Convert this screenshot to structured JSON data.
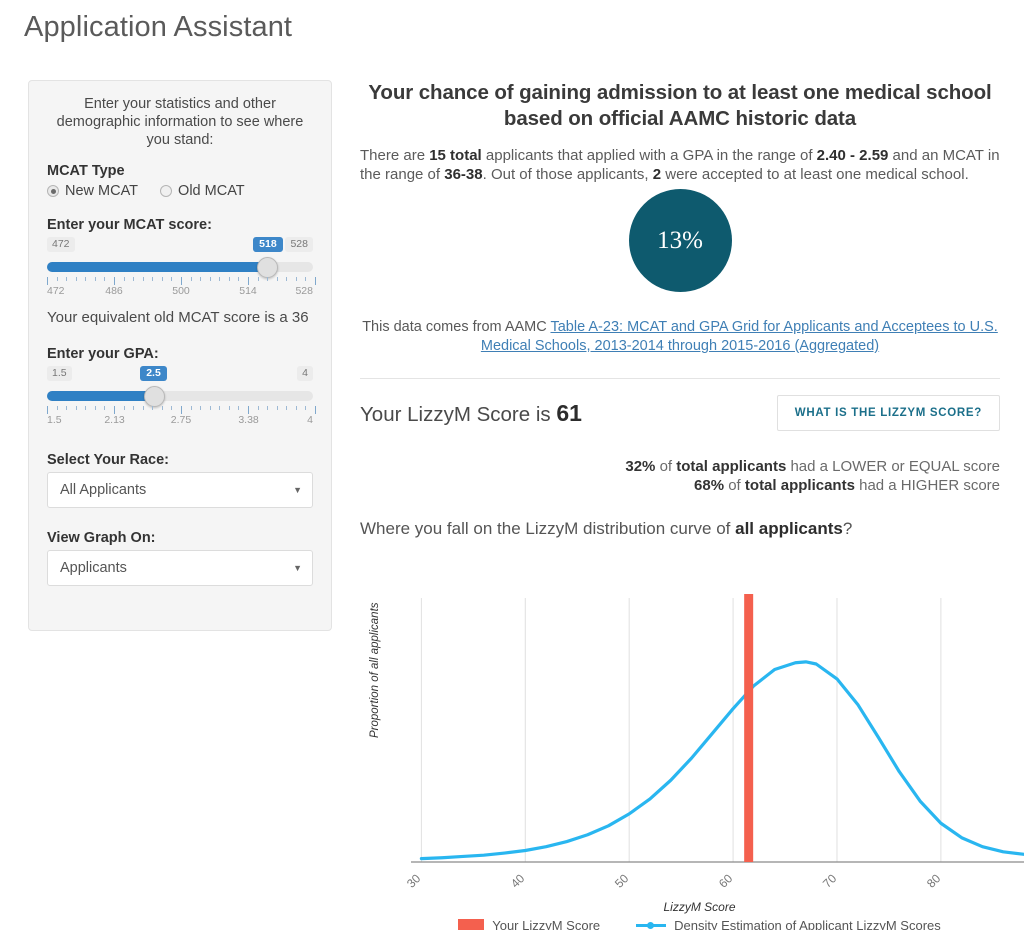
{
  "app": {
    "title": "Application Assistant"
  },
  "sidebar": {
    "intro": "Enter your statistics and other demographic information to see where you stand:",
    "mcat_type": {
      "label": "MCAT Type",
      "options": [
        {
          "label": "New MCAT",
          "selected": true
        },
        {
          "label": "Old MCAT",
          "selected": false
        }
      ]
    },
    "mcat_score": {
      "label": "Enter your MCAT score:",
      "min_cap": "472",
      "max_cap": "528",
      "current": "518",
      "min": 472,
      "max": 528,
      "value": 518,
      "tick_labels": [
        "472",
        "486",
        "500",
        "514",
        "528"
      ],
      "tick_values": [
        472,
        486,
        500,
        514,
        528
      ]
    },
    "equivalent_note": "Your equivalent old MCAT score is a 36",
    "gpa": {
      "label": "Enter your GPA:",
      "min_cap": "1.5",
      "max_cap": "4",
      "current": "2.5",
      "min": 1.5,
      "max": 4,
      "value": 2.5,
      "tick_labels": [
        "1.5",
        "2.13",
        "2.75",
        "3.38",
        "4"
      ],
      "tick_values": [
        1.5,
        2.13,
        2.75,
        3.38,
        4
      ]
    },
    "race": {
      "label": "Select Your Race:",
      "value": "All Applicants",
      "caret": "chevron-down-icon"
    },
    "view_graph_on": {
      "label": "View Graph On:",
      "value": "Applicants",
      "caret": "chevron-down-icon"
    }
  },
  "main": {
    "heading": "Your chance of gaining admission to at least one medical school based on official AAMC historic data",
    "summary": {
      "part1": "There are ",
      "total_applicants": "15 total",
      "part2": " applicants that applied with a GPA in the range of ",
      "gpa_range": "2.40 - 2.59",
      "part3": " and an MCAT in the range of ",
      "mcat_range": "36-38",
      "part4": ". Out of those applicants, ",
      "accepted": "2",
      "part5": " were accepted to at least one medical school."
    },
    "chance_percent": "13%",
    "chance_color": "#0e5a6e",
    "source": {
      "prefix": "This data comes from AAMC ",
      "link_text": "Table A-23: MCAT and GPA Grid for Applicants and Acceptees to U.S. Medical Schools, 2013-2014 through 2015-2016 (Aggregated)",
      "link_color": "#3f7fb5"
    },
    "lizzym": {
      "score_prefix": "Your LizzyM Score is ",
      "score_value": "61",
      "button_label": "WHAT IS THE LIZZYM SCORE?",
      "lower_pct": "32%",
      "lower_text_a": " of ",
      "lower_bold": "total applicants",
      "lower_text_b": " had a LOWER or EQUAL score",
      "higher_pct": "68%",
      "higher_text_a": " of ",
      "higher_bold": "total applicants",
      "higher_text_b": " had a HIGHER score"
    },
    "where_question": {
      "prefix": "Where you fall on the LizzyM distribution curve of ",
      "bold": "all applicants",
      "suffix": "?"
    }
  },
  "chart_data": {
    "type": "line",
    "title": "",
    "xlabel": "LizzyM Score",
    "ylabel": "Proportion of all applicants",
    "xlim": [
      29,
      88
    ],
    "ylim": [
      0,
      0.062
    ],
    "xticks": [
      30,
      40,
      50,
      60,
      70,
      80
    ],
    "xtick_labels": [
      "30",
      "40",
      "50",
      "60",
      "70",
      "80"
    ],
    "grid": "vertical",
    "legend_position": "bottom",
    "series": [
      {
        "name": "Density Estimation of Applicant LizzyM Scores",
        "color": "#29b6f0",
        "type": "line",
        "x": [
          30,
          32,
          34,
          36,
          38,
          40,
          42,
          44,
          46,
          48,
          50,
          52,
          54,
          56,
          58,
          60,
          62,
          64,
          66,
          67,
          68,
          70,
          72,
          74,
          76,
          78,
          80,
          82,
          84,
          86,
          88
        ],
        "y": [
          0.0008,
          0.001,
          0.0013,
          0.0016,
          0.0021,
          0.0027,
          0.0036,
          0.0048,
          0.0064,
          0.0085,
          0.0113,
          0.0148,
          0.0192,
          0.0244,
          0.0302,
          0.036,
          0.0414,
          0.0452,
          0.0468,
          0.047,
          0.0465,
          0.043,
          0.037,
          0.0292,
          0.0212,
          0.0143,
          0.0091,
          0.0057,
          0.0036,
          0.0024,
          0.0018
        ]
      },
      {
        "name": "Your LizzyM Score",
        "color": "#f4604e",
        "type": "vline",
        "x": 61.5,
        "value": 61
      }
    ],
    "legend": [
      {
        "label": "Your LizzyM Score",
        "color": "#f4604e",
        "marker": "bar"
      },
      {
        "label": "Density Estimation of Applicant LizzyM Scores",
        "color": "#29b6f0",
        "marker": "line"
      }
    ]
  }
}
